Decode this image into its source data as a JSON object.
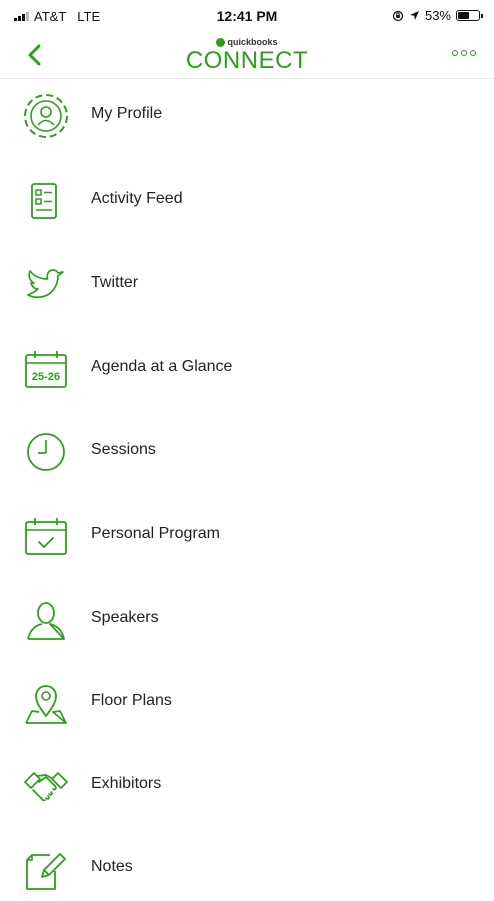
{
  "status_bar": {
    "carrier": "AT&T",
    "network": "LTE",
    "time": "12:41 PM",
    "battery": "53%",
    "battery_level": 0.53
  },
  "header": {
    "brand_small": "quickbooks",
    "brand_main": "CONNECT"
  },
  "menu": {
    "items": [
      {
        "label": "My Profile",
        "icon": "profile-icon"
      },
      {
        "label": "Activity Feed",
        "icon": "activity-feed-icon"
      },
      {
        "label": "Twitter",
        "icon": "twitter-icon"
      },
      {
        "label": "Agenda at a Glance",
        "icon": "calendar-icon",
        "icon_text": "25-26"
      },
      {
        "label": "Sessions",
        "icon": "clock-icon"
      },
      {
        "label": "Personal Program",
        "icon": "calendar-check-icon"
      },
      {
        "label": "Speakers",
        "icon": "person-icon"
      },
      {
        "label": "Floor Plans",
        "icon": "map-pin-icon"
      },
      {
        "label": "Exhibitors",
        "icon": "handshake-icon"
      },
      {
        "label": "Notes",
        "icon": "notes-icon"
      }
    ]
  },
  "colors": {
    "accent": "#2ca01c",
    "text": "#222222",
    "background": "#ffffff"
  }
}
